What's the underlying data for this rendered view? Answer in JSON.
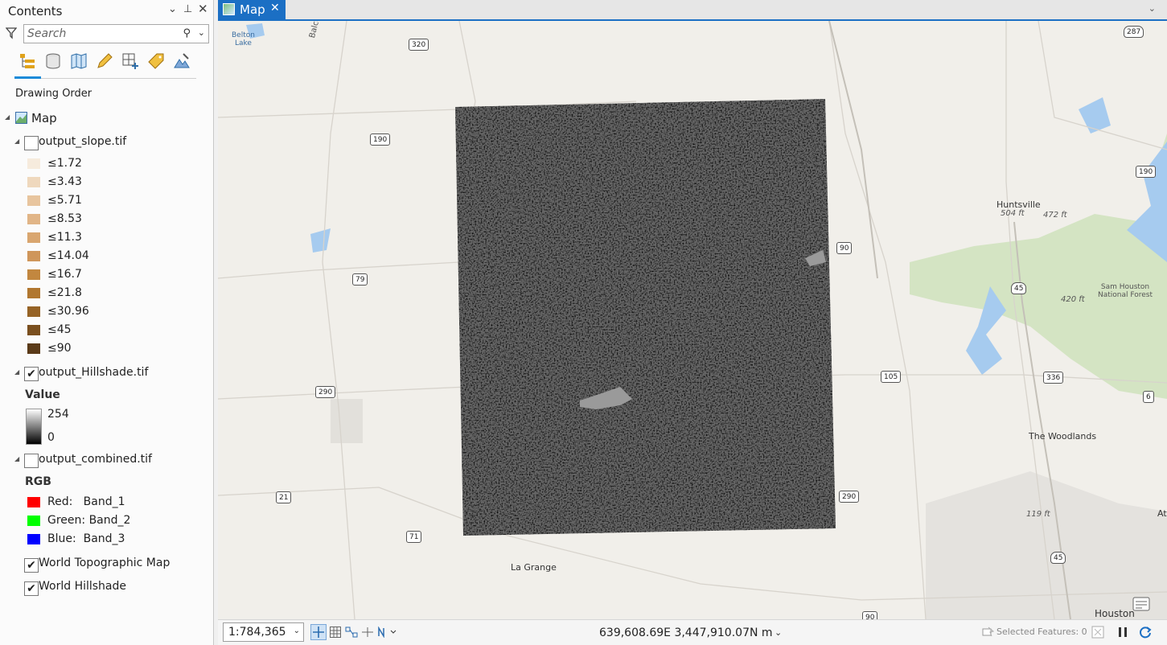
{
  "contents": {
    "title": "Contents",
    "search_placeholder": "Search",
    "drawing_order": "Drawing Order",
    "map_name": "Map"
  },
  "layers": {
    "slope": {
      "name": "output_slope.tif",
      "checked": false,
      "legend": [
        {
          "label": "≤1.72",
          "color": "#f6ebdd"
        },
        {
          "label": "≤3.43",
          "color": "#efd8bd"
        },
        {
          "label": "≤5.71",
          "color": "#e8c59e"
        },
        {
          "label": "≤8.53",
          "color": "#e1b587"
        },
        {
          "label": "≤11.3",
          "color": "#d9a66f"
        },
        {
          "label": "≤14.04",
          "color": "#cf965a"
        },
        {
          "label": "≤16.7",
          "color": "#c2873f"
        },
        {
          "label": "≤21.8",
          "color": "#b1772f"
        },
        {
          "label": "≤30.96",
          "color": "#966325"
        },
        {
          "label": "≤45",
          "color": "#7a4f1e"
        },
        {
          "label": "≤90",
          "color": "#5a3a18"
        }
      ]
    },
    "hillshade": {
      "name": "output_Hillshade.tif",
      "checked": true,
      "legend_title": "Value",
      "max": "254",
      "min": "0"
    },
    "combined": {
      "name": "output_combined.tif",
      "checked": false,
      "legend_title": "RGB",
      "bands": [
        {
          "label": "Red:   Band_1",
          "color": "#ff0000"
        },
        {
          "label": "Green: Band_2",
          "color": "#00ff00"
        },
        {
          "label": "Blue:  Band_3",
          "color": "#0000ff"
        }
      ]
    },
    "topo": {
      "name": "World Topographic Map",
      "checked": true
    },
    "world_hillshade": {
      "name": "World Hillshade",
      "checked": true
    }
  },
  "map": {
    "tab_label": "Map",
    "labels": {
      "belton_lake": "Belton\nLake",
      "balcones": "Balcones Escarp",
      "huntsville": "Huntsville",
      "sam_houston": "Sam Houston\nNational Forest",
      "the_woodlands": "The Woodlands",
      "la_grange": "La Grange",
      "houston": "Houston",
      "ata": "Ata"
    },
    "elevations": [
      "504 ft",
      "472 ft",
      "420 ft",
      "119 ft"
    ],
    "shields": [
      "320",
      "287",
      "190",
      "190",
      "90",
      "79",
      "45",
      "105",
      "336",
      "290",
      "21",
      "71",
      "290",
      "45",
      "90",
      "6"
    ]
  },
  "status": {
    "scale": "1:784,365",
    "coordinates": "639,608.69E 3,447,910.07N m",
    "selected_features": "Selected Features: 0"
  },
  "colors": {
    "accent": "#1b6fc4",
    "tab_underline": "#1b8ad8",
    "water": "#a6cbef",
    "forest": "#cfe0bf"
  }
}
